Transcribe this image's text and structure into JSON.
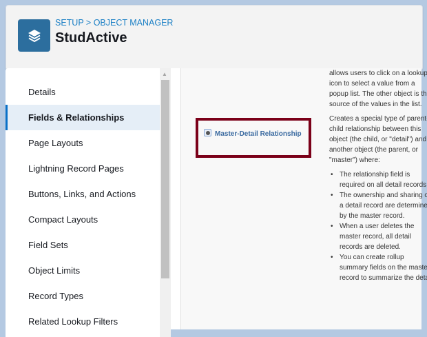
{
  "header": {
    "breadcrumb": "SETUP > OBJECT MANAGER",
    "title": "StudActive",
    "icon": "layers-icon",
    "color": "#2c6e9e"
  },
  "sidebar": {
    "items": [
      {
        "label": "Details"
      },
      {
        "label": "Fields & Relationships",
        "active": true
      },
      {
        "label": "Page Layouts"
      },
      {
        "label": "Lightning Record Pages"
      },
      {
        "label": "Buttons, Links, and Actions"
      },
      {
        "label": "Compact Layouts"
      },
      {
        "label": "Field Sets"
      },
      {
        "label": "Object Limits"
      },
      {
        "label": "Record Types"
      },
      {
        "label": "Related Lookup Filters"
      }
    ]
  },
  "main": {
    "option_label": "Master-Detail Relationship",
    "lookup_desc_tail": "allows users to click on a lookup icon to select a value from a popup list. The other object is the source of the values in the list.",
    "md_desc": "Creates a special type of parent-child relationship between this object (the child, or \"detail\") and another object (the parent, or \"master\") where:",
    "bullets": [
      "The relationship field is required on all detail records.",
      "The ownership and sharing of a detail record are determined by the master record.",
      "When a user deletes the master record, all detail records are deleted.",
      "You can create rollup summary fields on the master record to summarize the detail"
    ]
  }
}
